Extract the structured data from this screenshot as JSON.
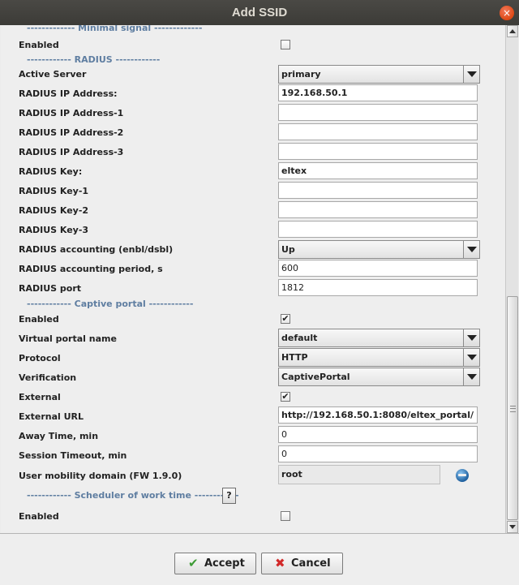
{
  "window": {
    "title": "Add SSID",
    "close_glyph": "×"
  },
  "sections": {
    "minimal_signal": "------------- Minimal signal -------------",
    "radius": "------------ RADIUS ------------",
    "captive_portal": "------------ Captive portal ------------",
    "scheduler": "------------ Scheduler of work time ------------"
  },
  "labels": {
    "enabled_min": "Enabled",
    "active_server": "Active Server",
    "radius_ip": "RADIUS IP Address:",
    "radius_ip1": "RADIUS IP Address-1",
    "radius_ip2": "RADIUS IP Address-2",
    "radius_ip3": "RADIUS IP Address-3",
    "radius_key": "RADIUS Key:",
    "radius_key1": "RADIUS Key-1",
    "radius_key2": "RADIUS Key-2",
    "radius_key3": "RADIUS Key-3",
    "radius_acct": "RADIUS accounting (enbl/dsbl)",
    "radius_acct_period": "RADIUS accounting period, s",
    "radius_port": "RADIUS port",
    "enabled_cp": "Enabled",
    "virtual_portal": "Virtual portal name",
    "protocol": "Protocol",
    "verification": "Verification",
    "external": "External",
    "external_url": "External URL",
    "away_time": "Away Time, min",
    "session_timeout": "Session Timeout, min",
    "mobility_domain": "User mobility domain (FW 1.9.0)",
    "enabled_sched": "Enabled"
  },
  "values": {
    "active_server": "primary",
    "radius_ip": "192.168.50.1",
    "radius_ip1": "",
    "radius_ip2": "",
    "radius_ip3": "",
    "radius_key": "eltex",
    "radius_key1": "",
    "radius_key2": "",
    "radius_key3": "",
    "radius_acct": "Up",
    "radius_acct_period": "600",
    "radius_port": "1812",
    "virtual_portal": "default",
    "protocol": "HTTP",
    "verification": "CaptivePortal",
    "external_url": "http://192.168.50.1:8080/eltex_portal/",
    "away_time": "0",
    "session_timeout": "0",
    "mobility_domain": "root"
  },
  "checkboxes": {
    "enabled_min": false,
    "enabled_cp": true,
    "external": true,
    "enabled_sched": false,
    "check_glyph": "✔"
  },
  "help_button": "?",
  "buttons": {
    "accept": "Accept",
    "accept_icon": "✔",
    "cancel": "Cancel",
    "cancel_icon": "✖"
  },
  "icons": {
    "accept": "check-icon",
    "cancel": "cross-icon",
    "globe": "globe-icon",
    "close": "close-icon"
  },
  "colors": {
    "section_text": "#5f7ea1",
    "accept_icon": "#3d9b35",
    "cancel_icon": "#d22a2a",
    "titlebar": "#3c3b37"
  }
}
